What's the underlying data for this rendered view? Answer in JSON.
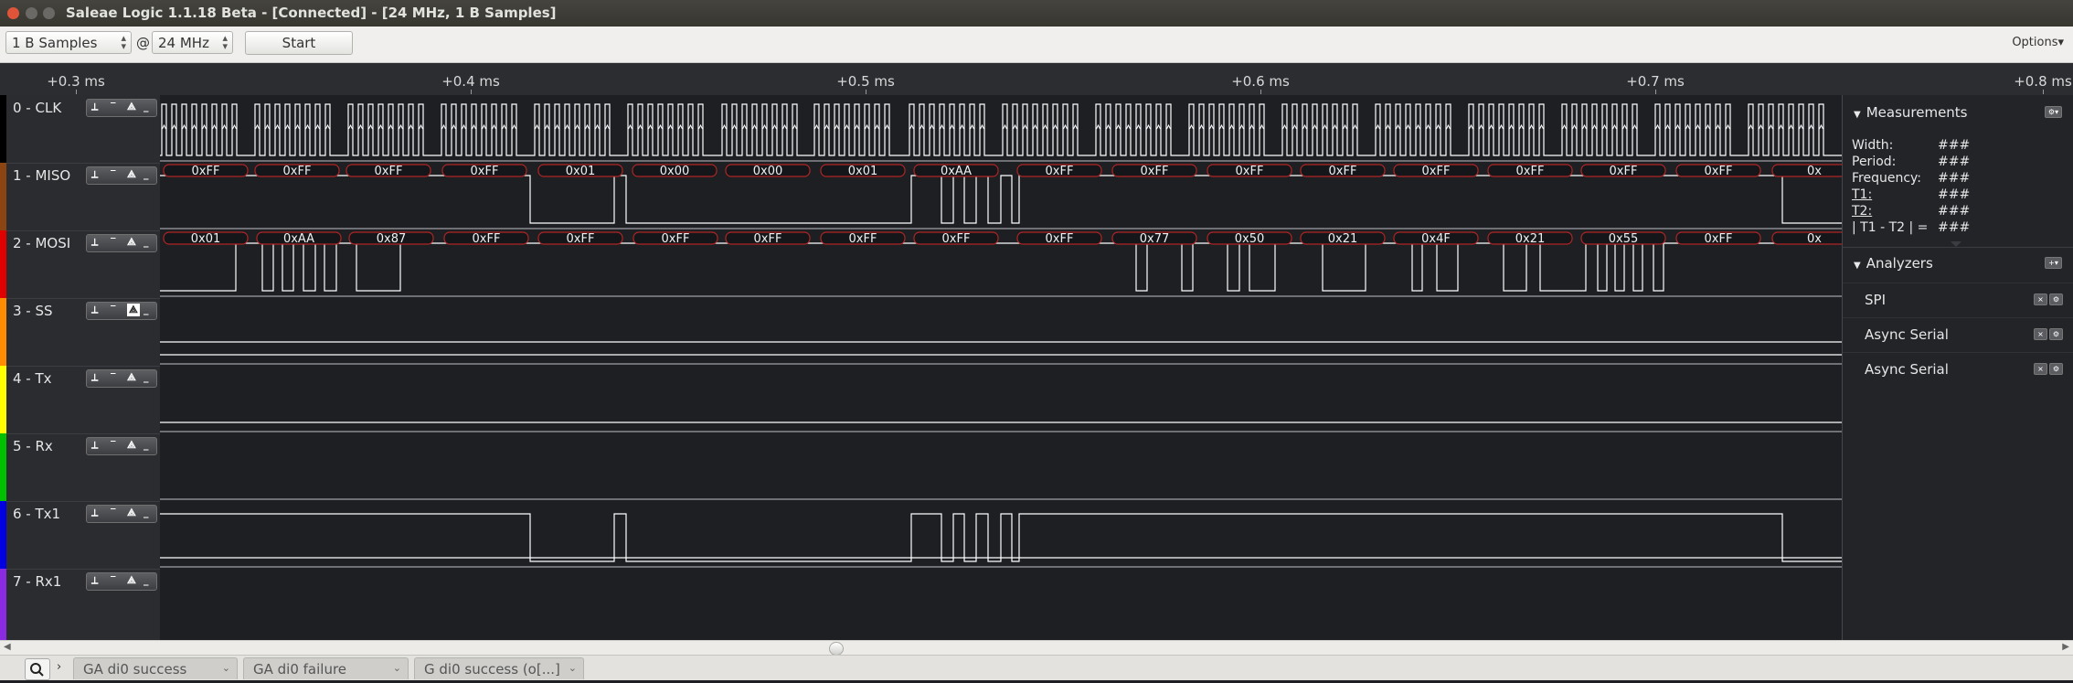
{
  "window": {
    "title": "Saleae Logic 1.1.18 Beta - [Connected] - [24 MHz, 1 B Samples]"
  },
  "toolbar": {
    "samples_value": "1 B Samples",
    "at_symbol": "@",
    "rate_value": "24 MHz",
    "start_label": "Start",
    "options_label": "Options▾"
  },
  "ruler": {
    "ticks": [
      "+0.3 ms",
      "+0.4 ms",
      "+0.5 ms",
      "+0.6 ms",
      "+0.7 ms",
      "+0.8 ms"
    ]
  },
  "channels": [
    {
      "name": "0 - CLK",
      "color": "#000000"
    },
    {
      "name": "1 - MISO",
      "color": "#8b4513"
    },
    {
      "name": "2 - MOSI",
      "color": "#e00000"
    },
    {
      "name": "3 - SS",
      "color": "#ff8c00"
    },
    {
      "name": "4 - Tx",
      "color": "#ffff00"
    },
    {
      "name": "5 - Rx",
      "color": "#00c000"
    },
    {
      "name": "6 - Tx1",
      "color": "#0000e0"
    },
    {
      "name": "7 - Rx1",
      "color": "#8a2be2"
    }
  ],
  "decoded": {
    "miso": [
      "0xFF",
      "0xFF",
      "0xFF",
      "0xFF",
      "0x01",
      "0x00",
      "0x00",
      "0x01",
      "0xAA",
      "0xFF",
      "0xFF",
      "0xFF",
      "0xFF",
      "0xFF",
      "0xFF",
      "0xFF",
      "0xFF",
      "0x"
    ],
    "mosi": [
      "0x01",
      "0xAA",
      "0x87",
      "0xFF",
      "0xFF",
      "0xFF",
      "0xFF",
      "0xFF",
      "0xFF",
      "0xFF",
      "0x77",
      "0x50",
      "0x21",
      "0x4F",
      "0x21",
      "0x55",
      "0xFF",
      "0x"
    ]
  },
  "measurements": {
    "header": "Measurements",
    "rows": [
      {
        "label": "Width:",
        "value": "###"
      },
      {
        "label": "Period:",
        "value": "###"
      },
      {
        "label": "Frequency:",
        "value": "###"
      },
      {
        "label": "T1:",
        "value": "###"
      },
      {
        "label": "T2:",
        "value": "###"
      },
      {
        "label": "| T1 - T2 | =",
        "value": "###"
      }
    ]
  },
  "analyzers": {
    "header": "Analyzers",
    "items": [
      "SPI",
      "Async Serial",
      "Async Serial"
    ]
  },
  "tabs": [
    "GA di0 success",
    "GA di0 failure",
    "G di0 success (o[...]"
  ],
  "colors": {
    "background": "#1d1f23",
    "trace": "#ffffff",
    "bubble_border": "#c02020"
  }
}
